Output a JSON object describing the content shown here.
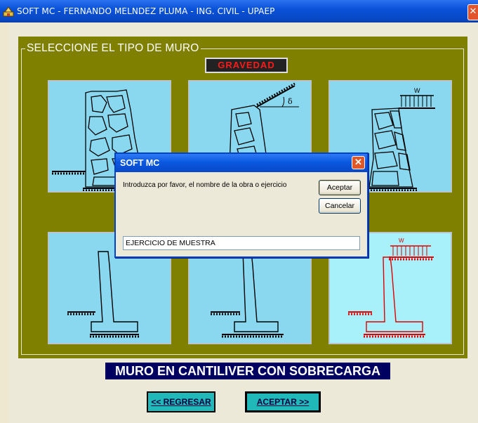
{
  "window": {
    "title": "SOFT MC - FERNANDO MELNDEZ PLUMA - ING. CIVIL - UPAEP",
    "close_glyph": "✕"
  },
  "panel": {
    "legend": "SELECCIONE EL TIPO DE MURO",
    "category_badge": "GRAVEDAD"
  },
  "tiles": [
    {
      "kind": "gravity-wall",
      "load_label": ""
    },
    {
      "kind": "gravity-wall-sloped-backfill",
      "angle_label": "δ"
    },
    {
      "kind": "gravity-wall-surcharge",
      "load_label": "W"
    },
    {
      "kind": "cantilever-wall",
      "load_label": ""
    },
    {
      "kind": "cantilever-wall",
      "load_label": ""
    },
    {
      "kind": "cantilever-wall-surcharge",
      "load_label": "W",
      "selected": true
    }
  ],
  "selection_label": "MURO EN CANTILIVER CON SOBRECARGA",
  "buttons": {
    "back": "<< REGRESAR",
    "accept": "ACEPTAR >>"
  },
  "dialog": {
    "title": "SOFT MC",
    "prompt": "Introduzca por favor, el nombre de la obra o ejercicio",
    "ok": "Aceptar",
    "cancel": "Cancelar",
    "input_value": "EJERCICIO DE MUESTRA",
    "close_glyph": "✕"
  },
  "colors": {
    "panel_background": "#808000",
    "tile_background": "#8ad8f0",
    "selected_tile_background": "#a8f0fa",
    "badge_text": "#ff1a1a",
    "banner_background": "#000060",
    "nav_button": "#20b8b8",
    "selected_drawing": "#e00000"
  }
}
